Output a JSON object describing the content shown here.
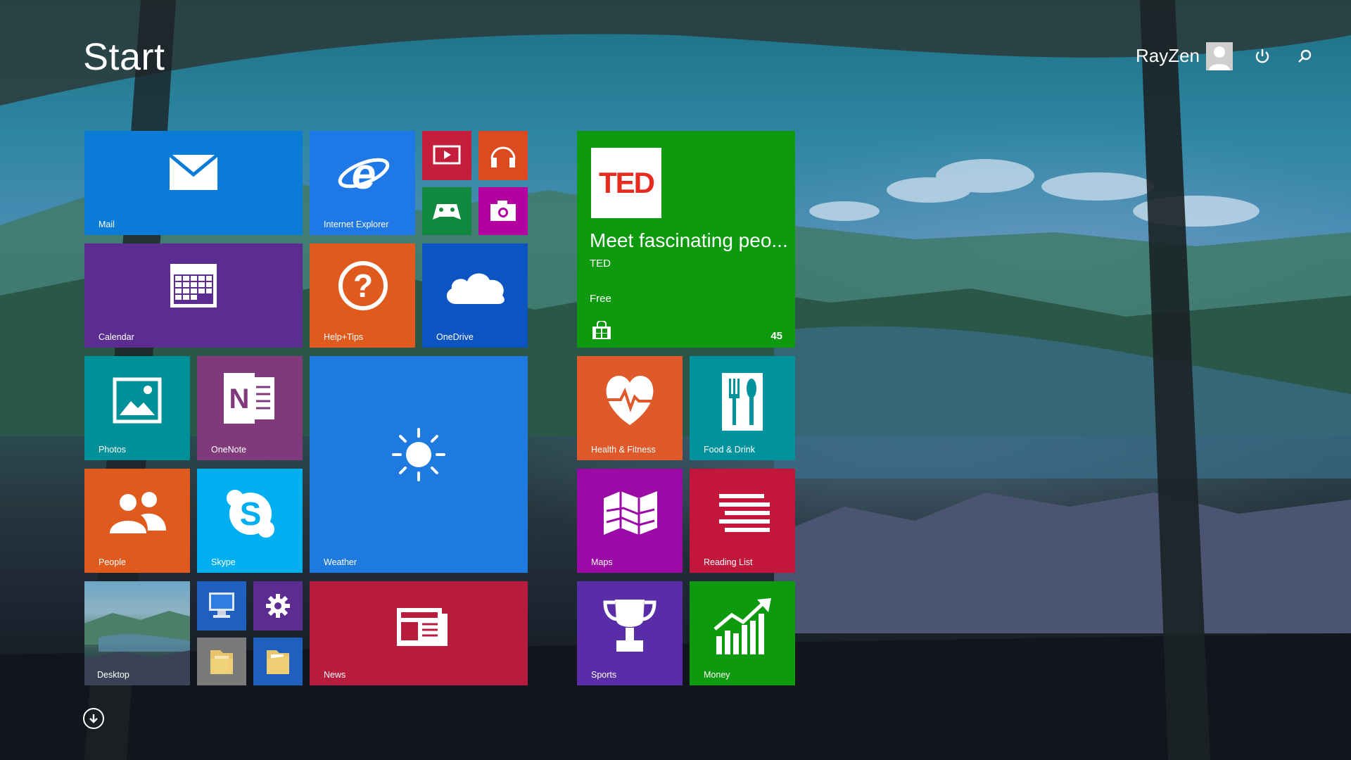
{
  "header": {
    "title": "Start",
    "user_name": "RayZen",
    "icons": {
      "avatar": "user-avatar-icon",
      "power": "power-icon",
      "search": "search-icon",
      "apps": "all-apps-arrow-icon"
    }
  },
  "colors": {
    "mail": "#0a7bd6",
    "ie": "#1e78e6",
    "video": "#c41e3a",
    "music": "#dc4a1f",
    "games": "#10893e",
    "camera": "#b4009e",
    "calendar": "#5c2d91",
    "help": "#e05a1e",
    "onedrive": "#0c54c2",
    "ted": "#0d9a0f",
    "photos": "#00909a",
    "onenote": "#80397b",
    "weather": "#1f7ae0",
    "health": "#e0592a",
    "food": "#00939e",
    "people": "#e05a1e",
    "skype": "#00aff0",
    "maps": "#9b0aa6",
    "reading": "#c3163b",
    "news": "#b71c3c",
    "sports": "#5a2da8",
    "money": "#0e9a0e"
  },
  "tiles": {
    "mail": "Mail",
    "internet_explorer": "Internet Explorer",
    "calendar": "Calendar",
    "help_tips": "Help+Tips",
    "onedrive": "OneDrive",
    "photos": "Photos",
    "onenote": "OneNote",
    "weather": "Weather",
    "people": "People",
    "skype": "Skype",
    "desktop": "Desktop",
    "news": "News",
    "health_fitness": "Health & Fitness",
    "food_drink": "Food & Drink",
    "maps": "Maps",
    "reading_list": "Reading List",
    "sports": "Sports",
    "money": "Money"
  },
  "ted": {
    "logo_text": "TED",
    "headline": "Meet fascinating peo...",
    "publisher": "TED",
    "price": "Free",
    "count": "45"
  }
}
